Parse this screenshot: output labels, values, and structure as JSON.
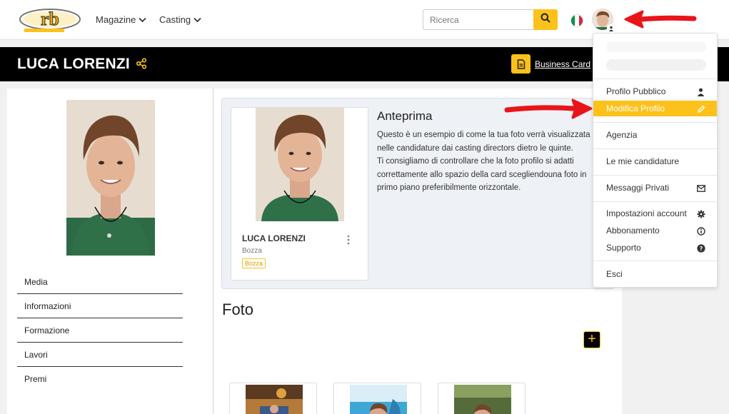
{
  "topbar": {
    "logo_text": "rb",
    "nav": [
      {
        "label": "Magazine"
      },
      {
        "label": "Casting"
      }
    ],
    "search": {
      "placeholder": "Ricerca"
    },
    "language": "it"
  },
  "header": {
    "name": "LUCA LORENZI",
    "business_card_label": "Business Card"
  },
  "sidebar": {
    "items": [
      {
        "label": "Media"
      },
      {
        "label": "Informazioni"
      },
      {
        "label": "Formazione"
      },
      {
        "label": "Lavori"
      },
      {
        "label": "Premi"
      }
    ]
  },
  "preview": {
    "title": "Anteprima",
    "lines": [
      "Questo è un esempio di come la tua foto verrà visualizzata",
      "nelle candidature dai casting directors dietro le quinte.",
      "Ti consigliamo di controllare che la foto profilo si adatti",
      "correttamente allo spazio della card scegliendouna foto in",
      "primo piano preferibilmente orizzontale."
    ],
    "card": {
      "name": "LUCA LORENZI",
      "status": "Bozza",
      "badge": "Bozza"
    }
  },
  "gallery": {
    "title": "Foto",
    "add_label": "+"
  },
  "dropdown": {
    "items": [
      {
        "label": "Profilo Pubblico",
        "icon": "user-icon"
      },
      {
        "label": "Modifica Profilo",
        "icon": "pencil-icon",
        "active": true
      },
      {
        "label": "Agenzia",
        "icon": ""
      },
      {
        "label": "Le mie candidature",
        "icon": ""
      },
      {
        "label": "Messaggi Privati",
        "icon": "envelope-icon"
      },
      {
        "label": "Impostazioni account",
        "icon": "gear-icon"
      },
      {
        "label": "Abbonamento",
        "icon": "info-icon"
      },
      {
        "label": "Supporto",
        "icon": "question-icon"
      },
      {
        "label": "Esci",
        "icon": ""
      }
    ]
  },
  "colors": {
    "accent": "#fcc21b",
    "header_bg": "#000000",
    "annotation_arrow": "#e8141a"
  }
}
